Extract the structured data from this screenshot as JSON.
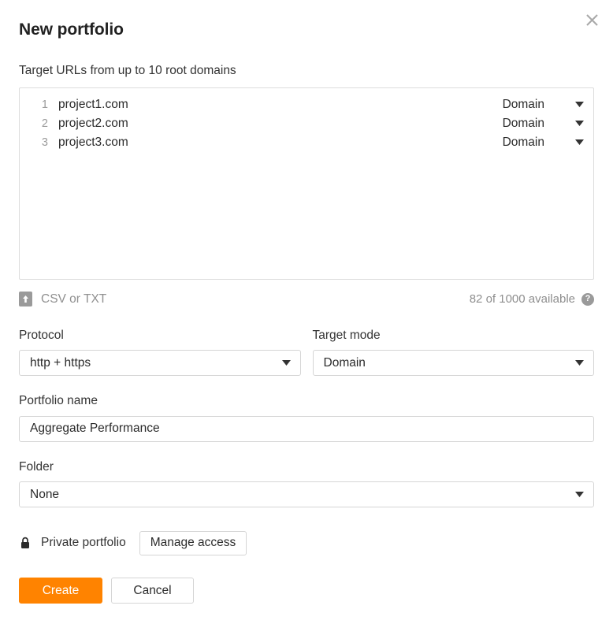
{
  "dialog": {
    "title": "New portfolio",
    "close_icon": "close-icon"
  },
  "targets": {
    "label": "Target URLs from up to 10 root domains",
    "rows": [
      {
        "num": "1",
        "url": "project1.com",
        "mode": "Domain"
      },
      {
        "num": "2",
        "url": "project2.com",
        "mode": "Domain"
      },
      {
        "num": "3",
        "url": "project3.com",
        "mode": "Domain"
      }
    ],
    "upload_label": "CSV or TXT",
    "upload_icon": "upload-file-icon",
    "quota_text": "82 of 1000 available",
    "help_icon": "help-circle-icon",
    "help_glyph": "?"
  },
  "protocol": {
    "label": "Protocol",
    "value": "http + https"
  },
  "target_mode": {
    "label": "Target mode",
    "value": "Domain"
  },
  "portfolio_name": {
    "label": "Portfolio name",
    "value": "Aggregate Performance",
    "placeholder": "Portfolio name"
  },
  "folder": {
    "label": "Folder",
    "value": "None"
  },
  "privacy": {
    "lock_icon": "lock-icon",
    "label": "Private portfolio",
    "manage_button": "Manage access"
  },
  "footer": {
    "create_label": "Create",
    "cancel_label": "Cancel"
  },
  "colors": {
    "accent": "#ff8300",
    "border": "#d5d5d5",
    "muted_text": "#909090"
  }
}
